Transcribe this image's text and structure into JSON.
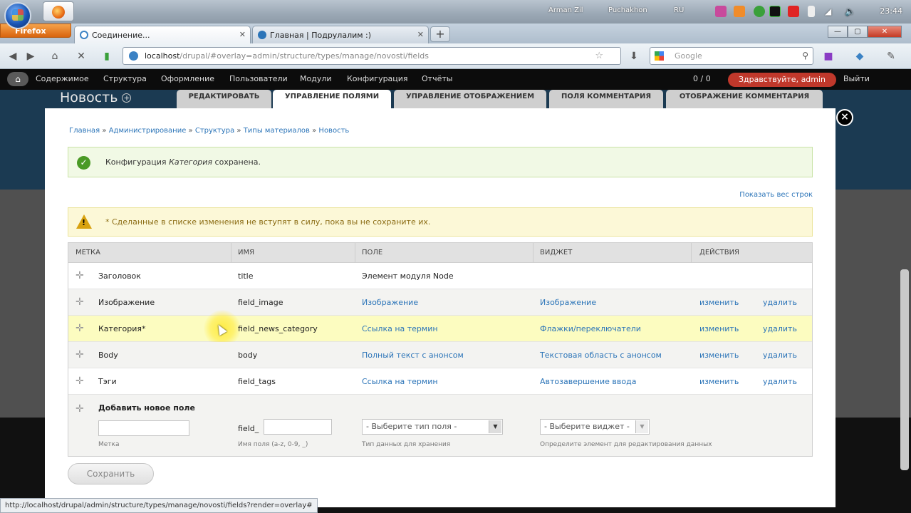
{
  "os": {
    "users": [
      "Arman Zil",
      "Puchakhon"
    ],
    "lang": "RU",
    "clock": "23:44"
  },
  "browser": {
    "app_button": "Firefox",
    "tabs": [
      {
        "title": "Соединение..."
      },
      {
        "title": "Главная | Подрулалим :)"
      }
    ],
    "url_host": "localhost",
    "url_path": "/drupal/#overlay=admin/structure/types/manage/novosti/fields",
    "search_placeholder": "Google",
    "status_url": "http://localhost/drupal/admin/structure/types/manage/novosti/fields?render=overlay#"
  },
  "toolbar": {
    "menu": [
      "Содержимое",
      "Структура",
      "Оформление",
      "Пользователи",
      "Модули",
      "Конфигурация",
      "Отчёты"
    ],
    "counter": "0 / 0",
    "greeting": "Здравствуйте, admin",
    "logout": "Выйти"
  },
  "overlay": {
    "title": "Новость",
    "tabs": [
      "РЕДАКТИРОВАТЬ",
      "УПРАВЛЕНИЕ ПОЛЯМИ",
      "УПРАВЛЕНИЕ ОТОБРАЖЕНИЕМ",
      "ПОЛЯ КОММЕНТАРИЯ",
      "ОТОБРАЖЕНИЕ КОММЕНТАРИЯ"
    ],
    "active_tab": 1
  },
  "breadcrumb": [
    "Главная",
    "Администрирование",
    "Структура",
    "Типы материалов",
    "Новость"
  ],
  "status_message": {
    "prefix": "Конфигурация ",
    "name": "Категория",
    "suffix": " сохранена."
  },
  "show_weights": "Показать вес строк",
  "warning": "* Сделанные в списке изменения не вступят в силу, пока вы не сохраните их.",
  "table": {
    "headers": [
      "МЕТКА",
      "ИМЯ",
      "ПОЛЕ",
      "ВИДЖЕТ",
      "ДЕЙСТВИЯ"
    ],
    "rows": [
      {
        "label": "Заголовок",
        "name": "title",
        "field": "Элемент модуля Node",
        "widget": "",
        "edit": "",
        "delete": ""
      },
      {
        "label": "Изображение",
        "name": "field_image",
        "field": "Изображение",
        "widget": "Изображение",
        "edit": "изменить",
        "delete": "удалить"
      },
      {
        "label": "Категория*",
        "name": "field_news_category",
        "field": "Ссылка на термин",
        "widget": "Флажки/переключатели",
        "edit": "изменить",
        "delete": "удалить"
      },
      {
        "label": "Body",
        "name": "body",
        "field": "Полный текст с анонсом",
        "widget": "Текстовая область с анонсом",
        "edit": "изменить",
        "delete": "удалить"
      },
      {
        "label": "Тэги",
        "name": "field_tags",
        "field": "Ссылка на термин",
        "widget": "Автозавершение ввода",
        "edit": "изменить",
        "delete": "удалить"
      }
    ],
    "add_new": {
      "title": "Добавить новое поле",
      "label_hint": "Метка",
      "name_prefix": "field_",
      "name_hint": "Имя поля (a-z, 0-9, _)",
      "type_select": "- Выберите тип поля -",
      "type_hint": "Тип данных для хранения",
      "widget_select": "- Выберите виджет -",
      "widget_hint": "Определите элемент для редактирования данных"
    }
  },
  "save_button": "Сохранить"
}
